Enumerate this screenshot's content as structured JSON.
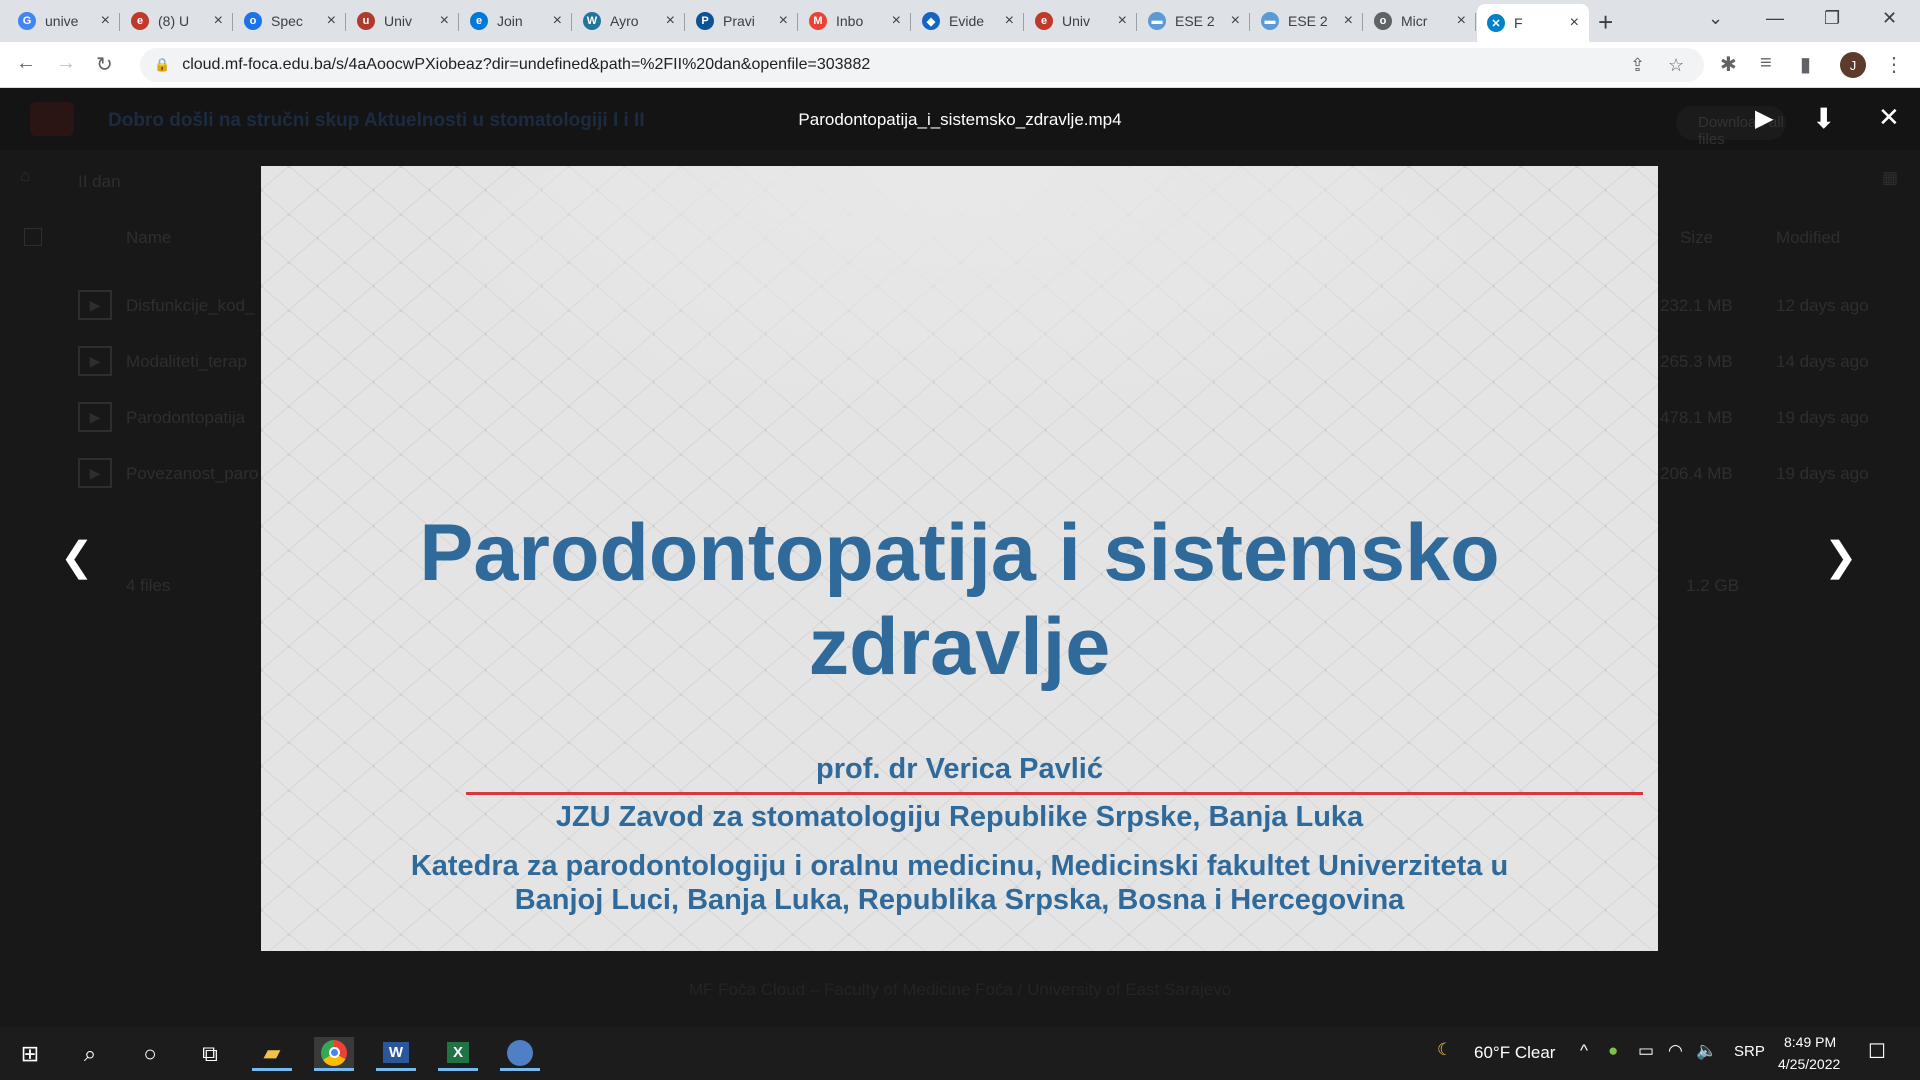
{
  "browser": {
    "tabs": [
      {
        "label": "unive",
        "icon": "google-icon",
        "color": "#4285f4",
        "glyph": "G"
      },
      {
        "label": "(8) U",
        "icon": "university-logo-icon",
        "color": "#c0392b",
        "glyph": "e"
      },
      {
        "label": "Spec",
        "icon": "globe-icon",
        "color": "#1a73e8",
        "glyph": "o"
      },
      {
        "label": "Univ",
        "icon": "crest-icon",
        "color": "#b03a2e",
        "glyph": "u"
      },
      {
        "label": "Join",
        "icon": "edge-icon",
        "color": "#0078d7",
        "glyph": "e"
      },
      {
        "label": "Ayro",
        "icon": "wordpress-icon",
        "color": "#21759b",
        "glyph": "W"
      },
      {
        "label": "Pravi",
        "icon": "institution-icon",
        "color": "#0b5394",
        "glyph": "P"
      },
      {
        "label": "Inbo",
        "icon": "gmail-icon",
        "color": "#ea4335",
        "glyph": "M"
      },
      {
        "label": "Evide",
        "icon": "diamond-icon",
        "color": "#1565c0",
        "glyph": "◆"
      },
      {
        "label": "Univ",
        "icon": "university-logo-icon",
        "color": "#c0392b",
        "glyph": "e"
      },
      {
        "label": "ESE 2",
        "icon": "flag-icon",
        "color": "#5b9bd5",
        "glyph": "▬"
      },
      {
        "label": "ESE 2",
        "icon": "flag-icon",
        "color": "#5b9bd5",
        "glyph": "▬"
      },
      {
        "label": "Micr",
        "icon": "globe-icon",
        "color": "#5f6368",
        "glyph": "o"
      },
      {
        "label": "F",
        "icon": "nextcloud-icon",
        "color": "#0082c9",
        "glyph": "✕",
        "active": true
      }
    ],
    "new_tab": "+",
    "url": "cloud.mf-foca.edu.ba/s/4aAoocwPXiobeaz?dir=undefined&path=%2FII%20dan&openfile=303882",
    "avatar_initial": "J"
  },
  "cloud": {
    "brand_title": "Dobro došli na stručni skup Aktuelnosti u stomatologiji I i II",
    "download_all": "Download all files",
    "breadcrumb": "II dan",
    "columns": {
      "name": "Name",
      "size": "Size",
      "modified": "Modified"
    },
    "files": [
      {
        "name": "Disfunkcije_kod_",
        "size": "232.1 MB",
        "modified": "12 days ago"
      },
      {
        "name": "Modaliteti_terap",
        "size": "265.3 MB",
        "modified": "14 days ago"
      },
      {
        "name": "Parodontopatija",
        "size": "478.1 MB",
        "modified": "19 days ago"
      },
      {
        "name": "Povezanost_paro",
        "size": "206.4 MB",
        "modified": "19 days ago"
      }
    ],
    "summary": {
      "count": "4 files",
      "total": "1.2 GB"
    },
    "footer": "MF Foča Cloud – Faculty of Medicine Foča / University of East Sarajevo"
  },
  "viewer": {
    "file_title": "Parodontopatija_i_sistemsko_zdravlje.mp4",
    "slide": {
      "title_line1": "Parodontopatija i sistemsko",
      "title_line2": "zdravlje",
      "author": "prof. dr Verica Pavlić",
      "institution": "JZU Zavod za stomatologiju Republike Srpske, Banja Luka",
      "department_line1": "Katedra za parodontologiju i oralnu medicinu, Medicinski fakultet Univerziteta u",
      "department_line2": "Banjoj Luci, Banja Luka, Republika Srpska, Bosna i Hercegovina"
    },
    "colors": {
      "title": "#2f6a9a",
      "rule": "#d9363e",
      "slide_bg": "#e4e4e4"
    }
  },
  "taskbar": {
    "weather": "60°F  Clear",
    "language": "SRP",
    "time": "8:49 PM",
    "date": "4/25/2022"
  }
}
